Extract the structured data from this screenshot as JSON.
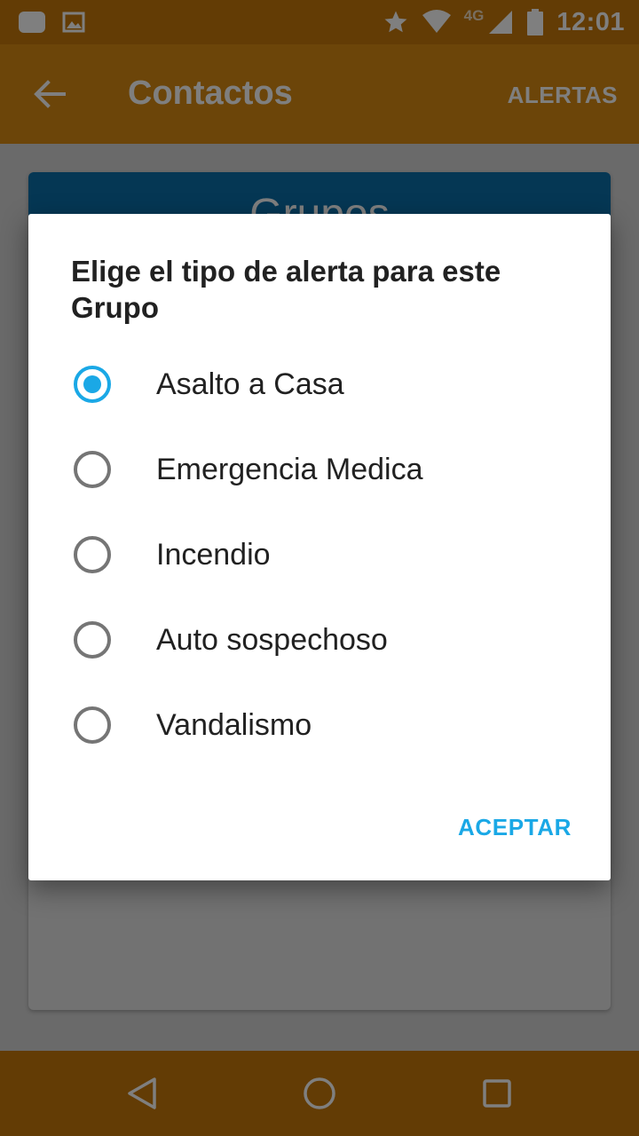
{
  "status_bar": {
    "time": "12:01",
    "network_label": "4G",
    "icons": [
      "notification-icon",
      "image-icon",
      "star-icon",
      "wifi-icon",
      "signal-icon",
      "battery-icon"
    ]
  },
  "app_bar": {
    "title": "Contactos",
    "action_label": "ALERTAS",
    "back_icon": "arrow-back-icon"
  },
  "card": {
    "header_title": "Grupos"
  },
  "dialog": {
    "title": "Elige el tipo de alerta para este Grupo",
    "selected": "Asalto a Casa",
    "options": [
      {
        "label": "Asalto a Casa",
        "checked": true
      },
      {
        "label": "Emergencia Medica",
        "checked": false
      },
      {
        "label": "Incendio",
        "checked": false
      },
      {
        "label": "Auto sospechoso",
        "checked": false
      },
      {
        "label": "Vandalismo",
        "checked": false
      }
    ],
    "accept_label": "ACEPTAR"
  },
  "nav_bar": {
    "icons": [
      "back-triangle-icon",
      "home-circle-icon",
      "recents-square-icon"
    ]
  },
  "colors": {
    "accent": "#1aa8e6",
    "app_bar": "#d88a12",
    "card_header": "#0a6ea8"
  }
}
